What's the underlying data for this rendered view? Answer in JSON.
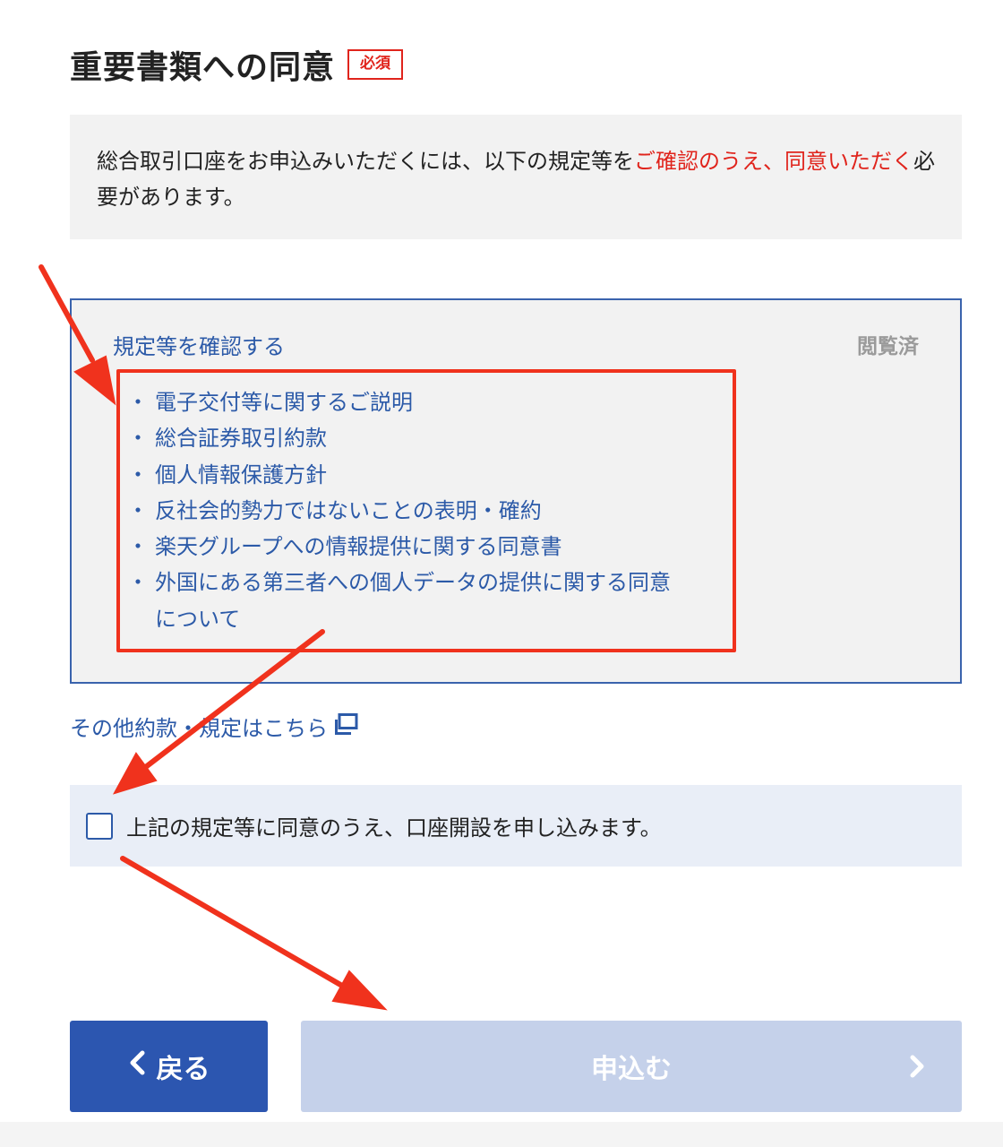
{
  "section": {
    "title": "重要書類への同意",
    "required_badge": "必須"
  },
  "notice": {
    "text_before": "総合取引口座をお申込みいただくには、以下の規定等を",
    "text_red": "ご確認のうえ、同意いただく",
    "text_after": "必要があります。"
  },
  "documents": {
    "link_label": "規定等を確認する",
    "status": "閲覧済",
    "items": [
      "電子交付等に関するご説明",
      "総合証券取引約款",
      "個人情報保護方針",
      "反社会的勢力ではないことの表明・確約",
      "楽天グループへの情報提供に関する同意書",
      "外国にある第三者への個人データの提供に関する同意について"
    ],
    "bullet": "・"
  },
  "other_terms": {
    "label": "その他約款・規定はこちら",
    "icon": "external-window-icon"
  },
  "agreement": {
    "checked": false,
    "label": "上記の規定等に同意のうえ、口座開設を申し込みます。"
  },
  "buttons": {
    "back_label": "戻る",
    "submit_label": "申込む",
    "submit_enabled": false
  },
  "colors": {
    "link_blue": "#2c5aa8",
    "required_red": "#e0241c",
    "annotation_red": "#f0321d",
    "back_button": "#2c56b0",
    "submit_disabled": "#c5d1ea"
  }
}
